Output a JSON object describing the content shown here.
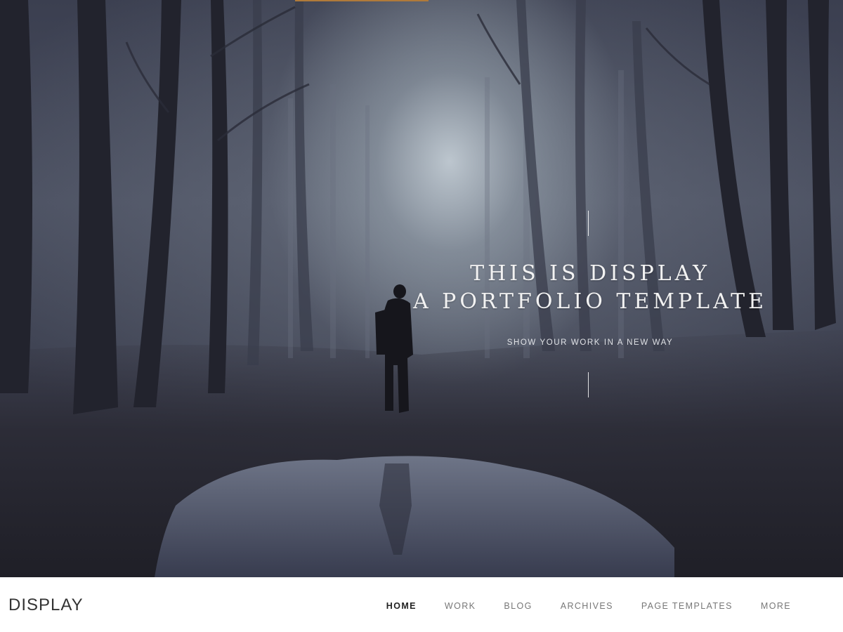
{
  "hero": {
    "headline_line1": "THIS IS DISPLAY",
    "headline_line2": "A PORTFOLIO TEMPLATE",
    "tagline": "SHOW YOUR WORK IN A NEW WAY"
  },
  "header": {
    "logo": "DISPLAY",
    "nav": [
      {
        "label": "HOME",
        "active": true
      },
      {
        "label": "WORK",
        "active": false
      },
      {
        "label": "BLOG",
        "active": false
      },
      {
        "label": "ARCHIVES",
        "active": false
      },
      {
        "label": "PAGE TEMPLATES",
        "active": false
      },
      {
        "label": "MORE",
        "active": false
      }
    ]
  },
  "colors": {
    "accent": "#b07a3a",
    "nav_active": "#222222",
    "nav_inactive": "#777777"
  }
}
